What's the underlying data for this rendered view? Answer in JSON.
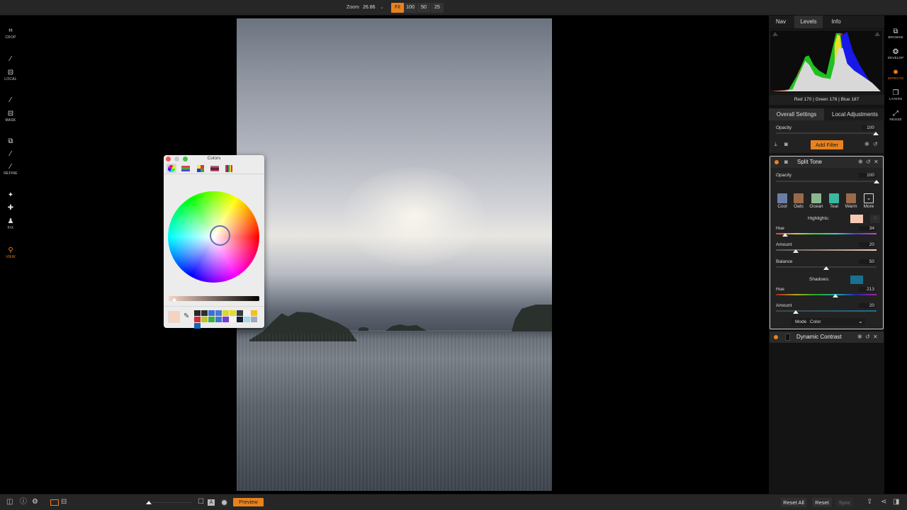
{
  "topbar": {
    "zoom_label": "Zoom",
    "zoom_value": "26.86",
    "zoom_chevron": "⌄",
    "zoom_buttons": [
      "Fit",
      "100",
      "50",
      "25"
    ],
    "zoom_active": "Fit"
  },
  "left_tools": [
    {
      "icon": "crop-icon",
      "glyph": "⌗",
      "label": "CROP"
    },
    {
      "icon": "local-brush-icon",
      "glyph": "⁄",
      "label": ""
    },
    {
      "icon": "local-icon",
      "glyph": "⊟",
      "label": "LOCAL"
    },
    {
      "icon": "mask-brush-icon",
      "glyph": "⁄",
      "label": ""
    },
    {
      "icon": "mask-icon",
      "glyph": "⊟",
      "label": "MASK"
    },
    {
      "icon": "refine-chip-icon",
      "glyph": "⧉",
      "label": ""
    },
    {
      "icon": "refine-brush-icon",
      "glyph": "⁄",
      "label": ""
    },
    {
      "icon": "refine-icon",
      "glyph": "⁄",
      "label": "REFINE"
    },
    {
      "icon": "retouch-icon",
      "glyph": "✦",
      "label": ""
    },
    {
      "icon": "bandage-icon",
      "glyph": "✚",
      "label": ""
    },
    {
      "icon": "fix-stamp-icon",
      "glyph": "♟",
      "label": "FIX"
    },
    {
      "icon": "view-magnifier-icon",
      "glyph": "⚲",
      "label": "VIEW"
    }
  ],
  "colors_window": {
    "title": "Colors",
    "toolbar": [
      "color-wheel",
      "color-sliders",
      "color-palettes",
      "image-palettes",
      "pencils"
    ],
    "current_color": "#f6d2bf",
    "swatches": [
      "#262626",
      "#2e2e2e",
      "#3c6fd4",
      "#4a78d0",
      "#d8d82a",
      "#e0dc30",
      "#3a3a3a",
      "#f2f2f2",
      "#f3c318",
      "#d42a3a",
      "#b8c828",
      "#3cae44",
      "#3c78d4",
      "#7a3cd4",
      "#f4f4f4",
      "#0e1e2e",
      "#a8d8ec",
      "#a0aab8",
      "#1468b4"
    ]
  },
  "right_panel": {
    "tabs": [
      "Nav",
      "Levels",
      "Info"
    ],
    "active_tab": "Levels",
    "histogram_readout": "Red 170  | Green 178  | Blue 187",
    "settings_tabs": [
      "Overall Settings",
      "Local Adjustments"
    ],
    "active_settings_tab": "Overall Settings",
    "overall": {
      "opacity_label": "Opacity",
      "opacity_value": "100",
      "opacity": 1.0,
      "add_filter": "Add Filter"
    },
    "split_tone": {
      "title": "Split Tone",
      "opacity_label": "Opacity",
      "opacity_value": "100",
      "opacity": 1.0,
      "presets": [
        {
          "label": "Cool",
          "color": "#6b7ea8"
        },
        {
          "label": "Oats",
          "color": "#9a6a48"
        },
        {
          "label": "Ocean",
          "color": "#8ab88e"
        },
        {
          "label": "Teal",
          "color": "#3ab8a0"
        },
        {
          "label": "Warm",
          "color": "#9a6a4a"
        },
        {
          "label": "More",
          "color": ""
        }
      ],
      "highlights_label": "Highlights:",
      "highlights_color": "#f6c9b5",
      "hue_label": "Hue",
      "hue_value": "34",
      "hue_fraction": 0.09,
      "amount_label": "Amount",
      "amount_value": "20",
      "amount_fraction": 0.2,
      "balance_label": "Balance",
      "balance_value": "50",
      "balance_fraction": 0.5,
      "shadows_label": "Shadows:",
      "shadows_color": "#1a7090",
      "shadow_hue_label": "Hue",
      "shadow_hue_value": "213",
      "shadow_hue_fraction": 0.59,
      "shadow_amount_label": "Amount",
      "shadow_amount_value": "20",
      "shadow_amount_fraction": 0.2,
      "mode_label": "Mode",
      "mode_value": "Color"
    },
    "dynamic_contrast": {
      "title": "Dynamic Contrast"
    }
  },
  "right_icons": [
    {
      "icon": "browse-icon",
      "glyph": "⧉",
      "label": "BROWSE"
    },
    {
      "icon": "develop-icon",
      "glyph": "❂",
      "label": "DEVELOP"
    },
    {
      "icon": "effects-icon",
      "glyph": "✹",
      "label": "EFFECTS"
    },
    {
      "icon": "layers-icon",
      "glyph": "❐",
      "label": "LAYERS"
    },
    {
      "icon": "resize-icon",
      "glyph": "⤢",
      "label": "RESIZE"
    }
  ],
  "bottombar": {
    "preview": "Preview",
    "reset_all": "Reset All",
    "reset": "Reset",
    "sync": "Sync"
  },
  "colors": {
    "accent": "#e8821e"
  }
}
